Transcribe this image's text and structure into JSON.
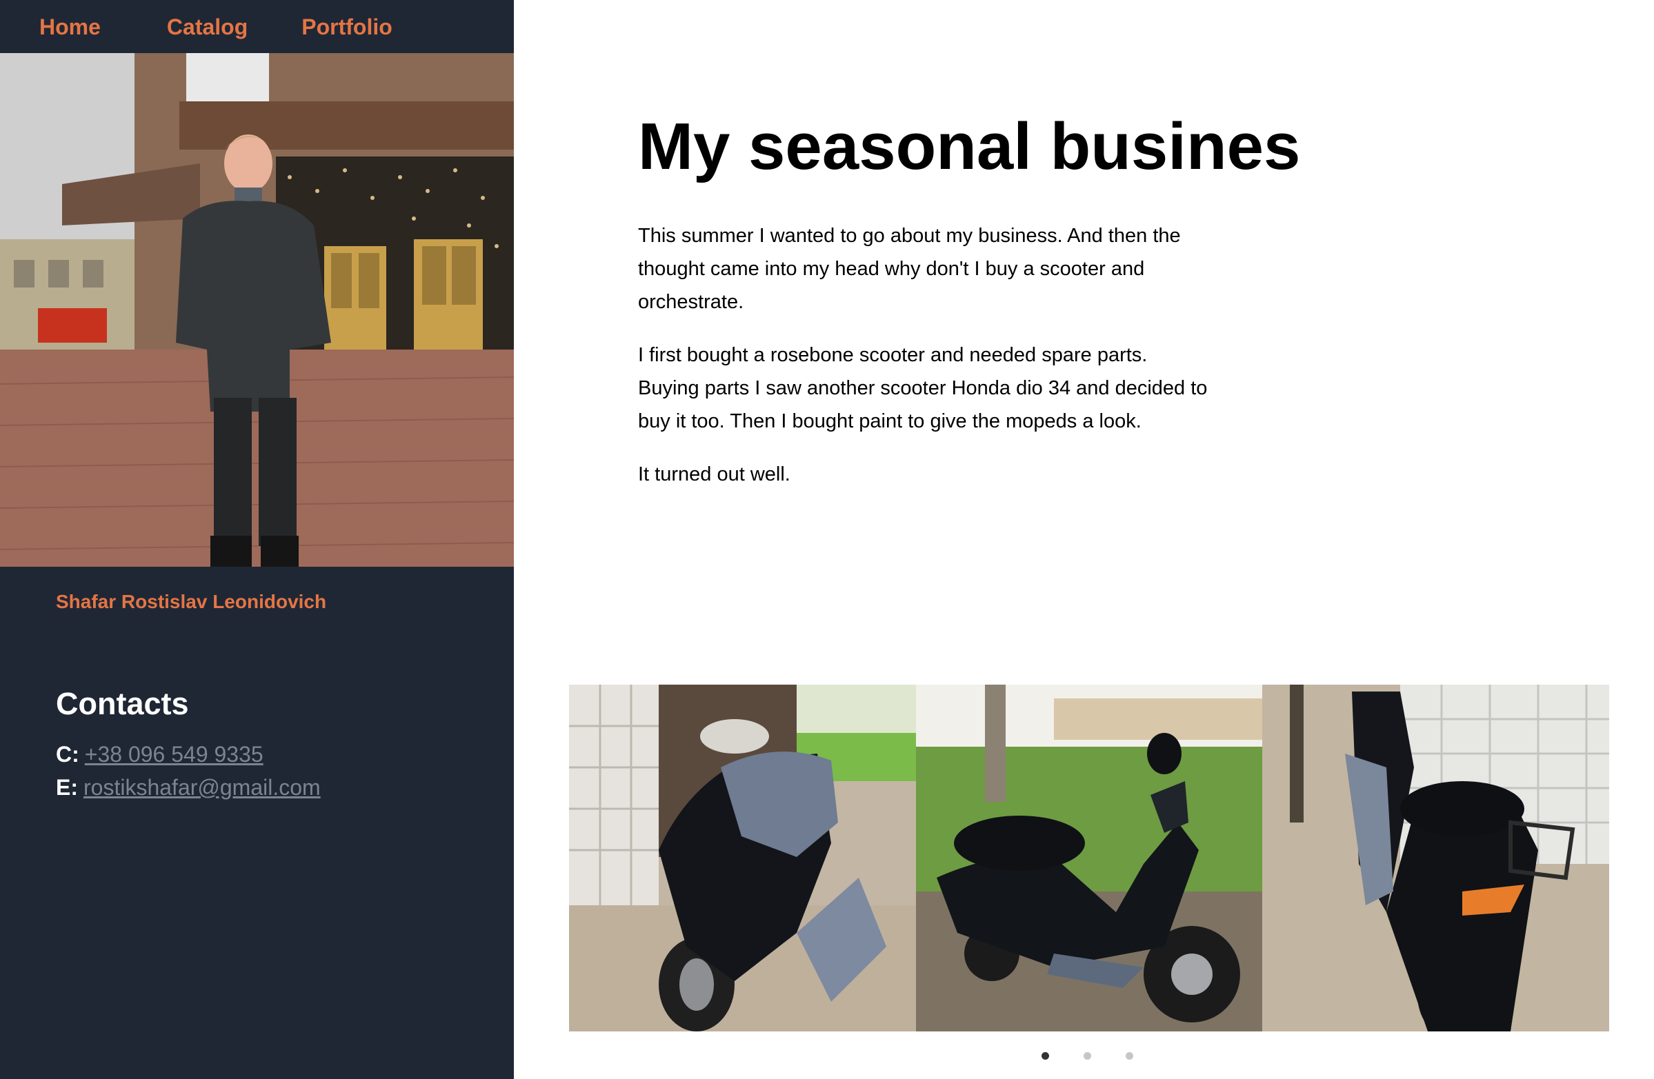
{
  "nav": {
    "items": [
      {
        "label": "Home"
      },
      {
        "label": "Catalog"
      },
      {
        "label": "Portfolio"
      }
    ]
  },
  "profile": {
    "photo_icon": "portrait-photo",
    "name": "Shafar Rostislav Leonidovich"
  },
  "contacts": {
    "title": "Contacts",
    "phone_key": "C:",
    "phone": "+38 096 549 9335",
    "email_key": "E:",
    "email": "rostikshafar@gmail.com"
  },
  "article": {
    "title": "My seasonal busines",
    "paragraphs": [
      "This summer I wanted to go about my business. And then the thought came into my head why don't I buy a scooter and orchestrate.",
      "I first bought a rosebone scooter and needed spare parts. Buying parts I saw another scooter Honda dio 34 and decided to buy it too. Then I bought paint to give the mopeds a look.",
      "It turned out well."
    ]
  },
  "gallery": {
    "slides": [
      {
        "icon": "scooter-photo-front"
      },
      {
        "icon": "scooter-photo-side"
      },
      {
        "icon": "scooter-photo-rear"
      }
    ],
    "dots_count": 3,
    "active_dot": 1
  },
  "colors": {
    "sidebar_bg": "#1f2735",
    "accent": "#e57544",
    "link": "#7c8391",
    "dot_active": "#333333",
    "dot_inactive": "#c6c6c6"
  }
}
